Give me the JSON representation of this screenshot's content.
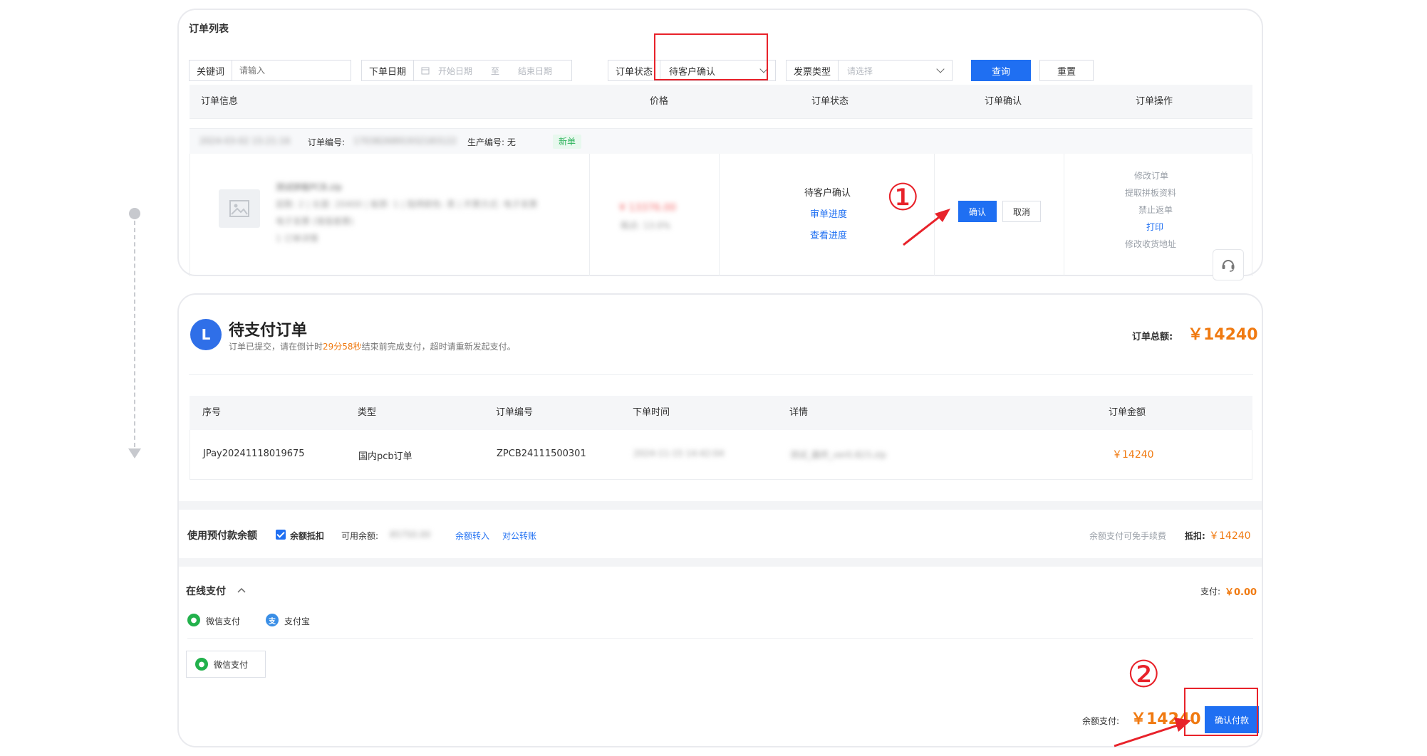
{
  "order_list": {
    "title": "订单列表",
    "filters": {
      "keyword_label": "关键词",
      "keyword_placeholder": "请输入",
      "date_label": "下单日期",
      "date_start_placeholder": "开始日期",
      "date_sep": "至",
      "date_end_placeholder": "结束日期",
      "status_label": "订单状态",
      "status_value": "待客户确认",
      "invoice_label": "发票类型",
      "invoice_placeholder": "请选择",
      "query_button": "查询",
      "reset_button": "重置"
    },
    "columns": [
      "订单信息",
      "价格",
      "订单状态",
      "订单确认",
      "订单操作"
    ],
    "order": {
      "date_blur": "2024-03-02 15:21:16",
      "order_no_label": "订单编号:",
      "order_no_blur": "1703826891932183122",
      "production_label": "生产编号: 无",
      "tag": "新单",
      "info_blur_lines": [
        "测试拼板PCB.zip",
        "层数: 2 | 长度: 20400 | 板厚: 1 | 阻焊颜色: 黑 | 开票方式: 电子发票",
        "电子发票 (增值普票)",
        "1 订单详情"
      ],
      "price_blur": "¥ 13376.00",
      "price_sub_blur": "税点: 13.0%",
      "status": "待客户确认",
      "status_link1": "审单进度",
      "status_link2": "查看进度",
      "confirm_button": "确认",
      "cancel_button": "取消",
      "ops": [
        "修改订单",
        "提取拼板资料",
        "禁止返单",
        "打印",
        "修改收货地址"
      ]
    }
  },
  "annotations": {
    "step1": "①",
    "step2": "②"
  },
  "payment": {
    "avatar_letter": "L",
    "title": "待支付订单",
    "subtitle_prefix": "订单已提交，请在倒计时",
    "countdown": "29分58秒",
    "subtitle_suffix": "结束前完成支付，超时请重新发起支付。",
    "total_label": "订单总额:",
    "total_value": "￥14240",
    "table_columns": [
      "序号",
      "类型",
      "订单编号",
      "下单时间",
      "详情",
      "订单金额"
    ],
    "row": {
      "seq": "JPay20241118019675",
      "type": "国内pcb订单",
      "order_no": "ZPCB24111500301",
      "time_blur": "2024-11-15 14:42:04",
      "detail_blur": "测试_最终_ver0.823.zip",
      "amount": "￥14240"
    },
    "prepaid": {
      "title": "使用预付款余额",
      "checkbox_label": "余额抵扣",
      "available_label": "可用余额:",
      "available_blur": "85750.00",
      "link_transfer_in": "余额转入",
      "link_corporate": "对公转账",
      "note": "余额支付可免手续费",
      "deduct_label": "抵扣:",
      "deduct_value": "￥14240"
    },
    "online": {
      "title": "在线支付",
      "pay_label": "支付:",
      "pay_value": "￥0.00",
      "method_wechat": "微信支付",
      "method_alipay": "支付宝",
      "selected_method": "微信支付"
    },
    "balance_pay_label": "余额支付:",
    "balance_pay_value": "￥14240",
    "confirm_pay_button": "确认付款"
  },
  "colors": {
    "primary": "#1f6ff2",
    "accent_orange": "#f07a11",
    "annotation_red": "#e8222a",
    "wechat_green": "#22b14c",
    "alipay_blue": "#3a8ee6"
  }
}
